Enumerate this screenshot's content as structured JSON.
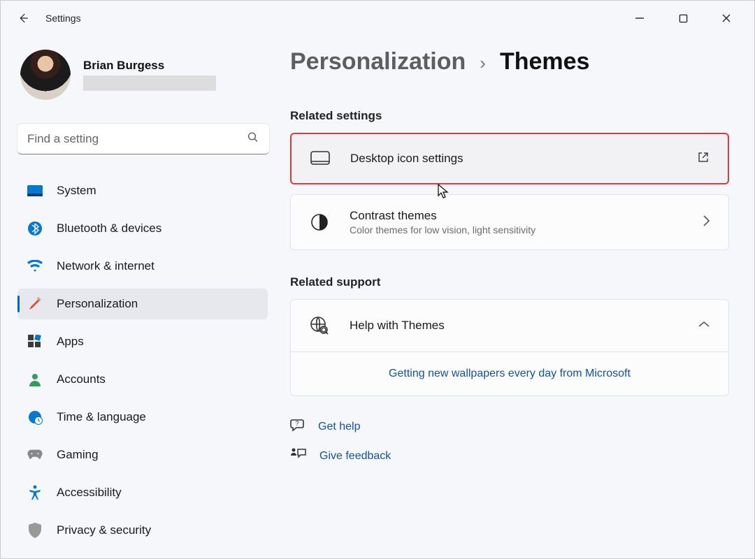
{
  "app": {
    "title": "Settings"
  },
  "profile": {
    "name": "Brian Burgess"
  },
  "search": {
    "placeholder": "Find a setting"
  },
  "nav": {
    "items": [
      {
        "label": "System"
      },
      {
        "label": "Bluetooth & devices"
      },
      {
        "label": "Network & internet"
      },
      {
        "label": "Personalization"
      },
      {
        "label": "Apps"
      },
      {
        "label": "Accounts"
      },
      {
        "label": "Time & language"
      },
      {
        "label": "Gaming"
      },
      {
        "label": "Accessibility"
      },
      {
        "label": "Privacy & security"
      }
    ]
  },
  "breadcrumb": {
    "parent": "Personalization",
    "current": "Themes"
  },
  "sections": {
    "related_settings": {
      "title": "Related settings",
      "desktop_icon": {
        "title": "Desktop icon settings"
      },
      "contrast": {
        "title": "Contrast themes",
        "sub": "Color themes for low vision, light sensitivity"
      }
    },
    "related_support": {
      "title": "Related support",
      "help": {
        "title": "Help with Themes"
      },
      "wallpapers_link": "Getting new wallpapers every day from Microsoft"
    }
  },
  "footer_links": {
    "get_help": "Get help",
    "give_feedback": "Give feedback"
  }
}
